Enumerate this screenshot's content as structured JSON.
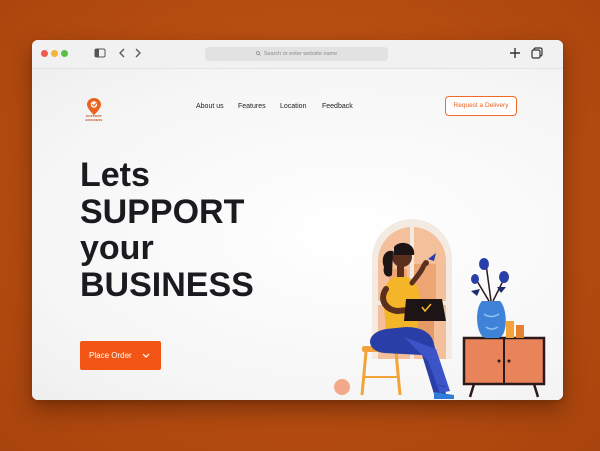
{
  "browser": {
    "address_placeholder": "Search or enter website name"
  },
  "brand": {
    "logo_text": "SUPPORT BUSINESS"
  },
  "nav": {
    "items": [
      "About us",
      "Features",
      "Location",
      "Feedback"
    ],
    "request_label": "Request a Delivery"
  },
  "hero": {
    "line1": "Lets",
    "line2": "SUPPORT",
    "line3": "your",
    "line4": "BUSINESS"
  },
  "cta": {
    "label": "Place Order"
  },
  "colors": {
    "accent": "#f35614",
    "background": "#b44c10",
    "headline": "#1b1b1f"
  },
  "icons": [
    "sidebar-icon",
    "back-chevron-icon",
    "forward-chevron-icon",
    "search-icon",
    "plus-icon",
    "tabs-icon",
    "chevron-down-icon"
  ]
}
